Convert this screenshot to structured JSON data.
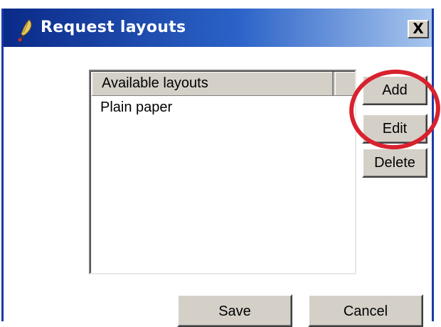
{
  "window": {
    "title": "Request layouts",
    "close_label": "X",
    "title_icon": "feather-quill-icon"
  },
  "list": {
    "column_header": "Available layouts",
    "items": [
      "Plain paper"
    ]
  },
  "side_buttons": {
    "add_label": "Add",
    "edit_label": "Edit",
    "delete_label": "Delete"
  },
  "footer": {
    "save_label": "Save",
    "cancel_label": "Cancel"
  },
  "annotation": {
    "type": "highlight-circle",
    "color": "#d8222e"
  },
  "colors": {
    "titlebar_start": "#0a2a88",
    "titlebar_end": "#a9c7ee",
    "button_face": "#d4d0c8"
  }
}
